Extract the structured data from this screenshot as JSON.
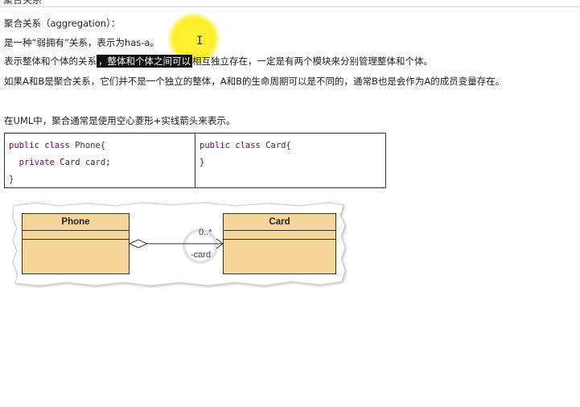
{
  "header": {
    "cut_title": "聚合关系"
  },
  "doc": {
    "heading": "聚合关系（aggregation）：",
    "line1": "是一种“弱拥有”关系，表示为has-a。",
    "line2_pre": "表示整体和个体的关系",
    "line2_highlight": "，整体和个体之间可以",
    "line2_post": "相互独立存在，一定是有两个模块来分别管理整体和个体。",
    "line3": "如果A和B是聚合关系，它们并不是一个独立的整体，A和B的生命周期可以是不同的，通常B也是会作为A的成员变量存在。",
    "line4": "在UML中，聚合通常是使用空心菱形+实线箭头来表示。"
  },
  "code": {
    "left": {
      "l1_kw": "public class",
      "l1_rest": " Phone{",
      "l2_kw": "private",
      "l2_rest": " Card card;",
      "l3": "}"
    },
    "right": {
      "l1_kw": "public class",
      "l1_rest": " Card{",
      "l2": "}"
    }
  },
  "uml": {
    "phone": "Phone",
    "card": "Card",
    "multiplicity": "0..*",
    "role": "-card",
    "box_fill": "#f5d59a"
  },
  "icons": {
    "cursor": "text-cursor-icon",
    "watermark": "watermark-logo"
  }
}
